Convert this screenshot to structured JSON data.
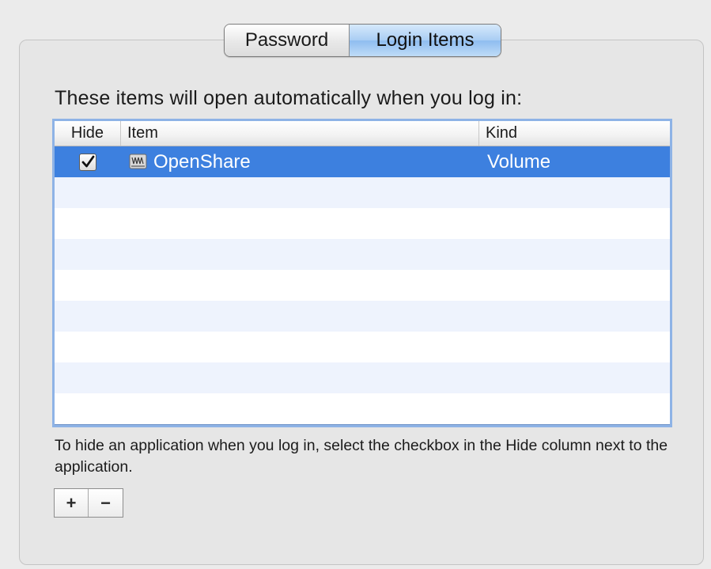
{
  "tabs": [
    {
      "label": "Password",
      "selected": false
    },
    {
      "label": "Login Items",
      "selected": true
    }
  ],
  "intro_text": "These items will open automatically when you log in:",
  "table": {
    "columns": [
      "Hide",
      "Item",
      "Kind"
    ],
    "rows": [
      {
        "hide_checked": true,
        "item": "OpenShare",
        "kind": "Volume",
        "icon": "volume-icon",
        "selected": true
      }
    ]
  },
  "help_text": "To hide an application when you log in, select the checkbox in the Hide column next to the application.",
  "buttons": {
    "add_label": "+",
    "remove_label": "−"
  },
  "colors": {
    "selection": "#3d80df",
    "alt_row": "#eef3fd",
    "focus_ring": "#8eb3e6"
  }
}
